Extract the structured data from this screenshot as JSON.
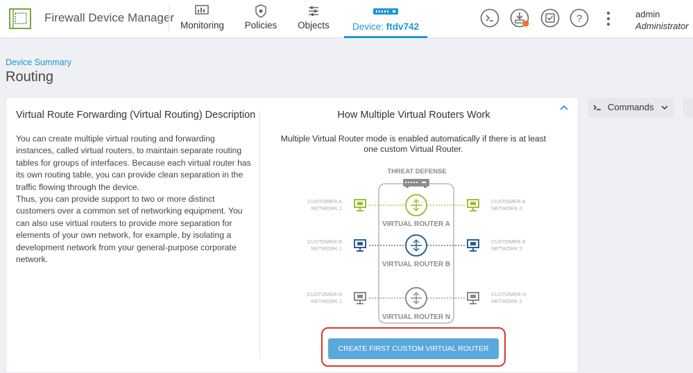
{
  "header": {
    "app_title": "Firewall Device Manager",
    "nav": [
      {
        "label": "Monitoring",
        "icon": "monitoring-icon"
      },
      {
        "label": "Policies",
        "icon": "policies-shield-icon"
      },
      {
        "label": "Objects",
        "icon": "objects-sliders-icon"
      }
    ],
    "device_prefix": "Device: ",
    "device_name": "ftdv742",
    "actions": [
      "cli-console-icon",
      "deploy-download-icon",
      "task-list-icon",
      "help-icon",
      "more-options-icon"
    ],
    "user": {
      "name": "admin",
      "role": "Administrator"
    }
  },
  "breadcrumb": "Device Summary",
  "page_title": "Routing",
  "card": {
    "left": {
      "title": "Virtual Route Forwarding (Virtual Routing) Description",
      "paragraph1": "You can create multiple virtual routing and forwarding instances, called virtual routers, to maintain separate routing tables for groups of interfaces. Because each virtual router has its own routing table, you can provide clean separation in the traffic flowing through the device.",
      "paragraph2": "Thus, you can provide support to two or more distinct customers over a common set of networking equipment. You can also use virtual routers to provide more separation for elements of your own network, for example, by isolating a development network from your general-purpose corporate network."
    },
    "right": {
      "title": "How Multiple Virtual Routers Work",
      "subtitle": "Multiple Virtual Router mode is enabled automatically if there is at least one custom Virtual Router.",
      "diagram": {
        "device_label": "THREAT DEFENSE",
        "rows": [
          {
            "left_line1": "CUSTOMER A",
            "left_line2": "NETWORK 1",
            "right_line1": "CUSTOMER A",
            "right_line2": "NETWORK 2",
            "router_label": "VIRTUAL ROUTER A",
            "color": "#9fbe3a"
          },
          {
            "left_line1": "CUSTOMER B",
            "left_line2": "NETWORK 1",
            "right_line1": "CUSTOMER B",
            "right_line2": "NETWORK 2",
            "router_label": "VIRTUAL ROUTER B",
            "color": "#2f5f8f"
          },
          {
            "left_line1": "CUSTOMER N",
            "left_line2": "NETWORK 1",
            "right_line1": "CUSTOMER N",
            "right_line2": "NETWORK 2",
            "router_label": "VIRTUAL ROUTER N",
            "color": "#8a8a8a"
          }
        ]
      },
      "button_label": "CREATE FIRST CUSTOM VIRTUAL ROUTER"
    }
  },
  "commands": {
    "label": "Commands"
  },
  "colors": {
    "accent": "#1e98d6",
    "button": "#5aa9dc",
    "highlight": "#d9382f"
  }
}
